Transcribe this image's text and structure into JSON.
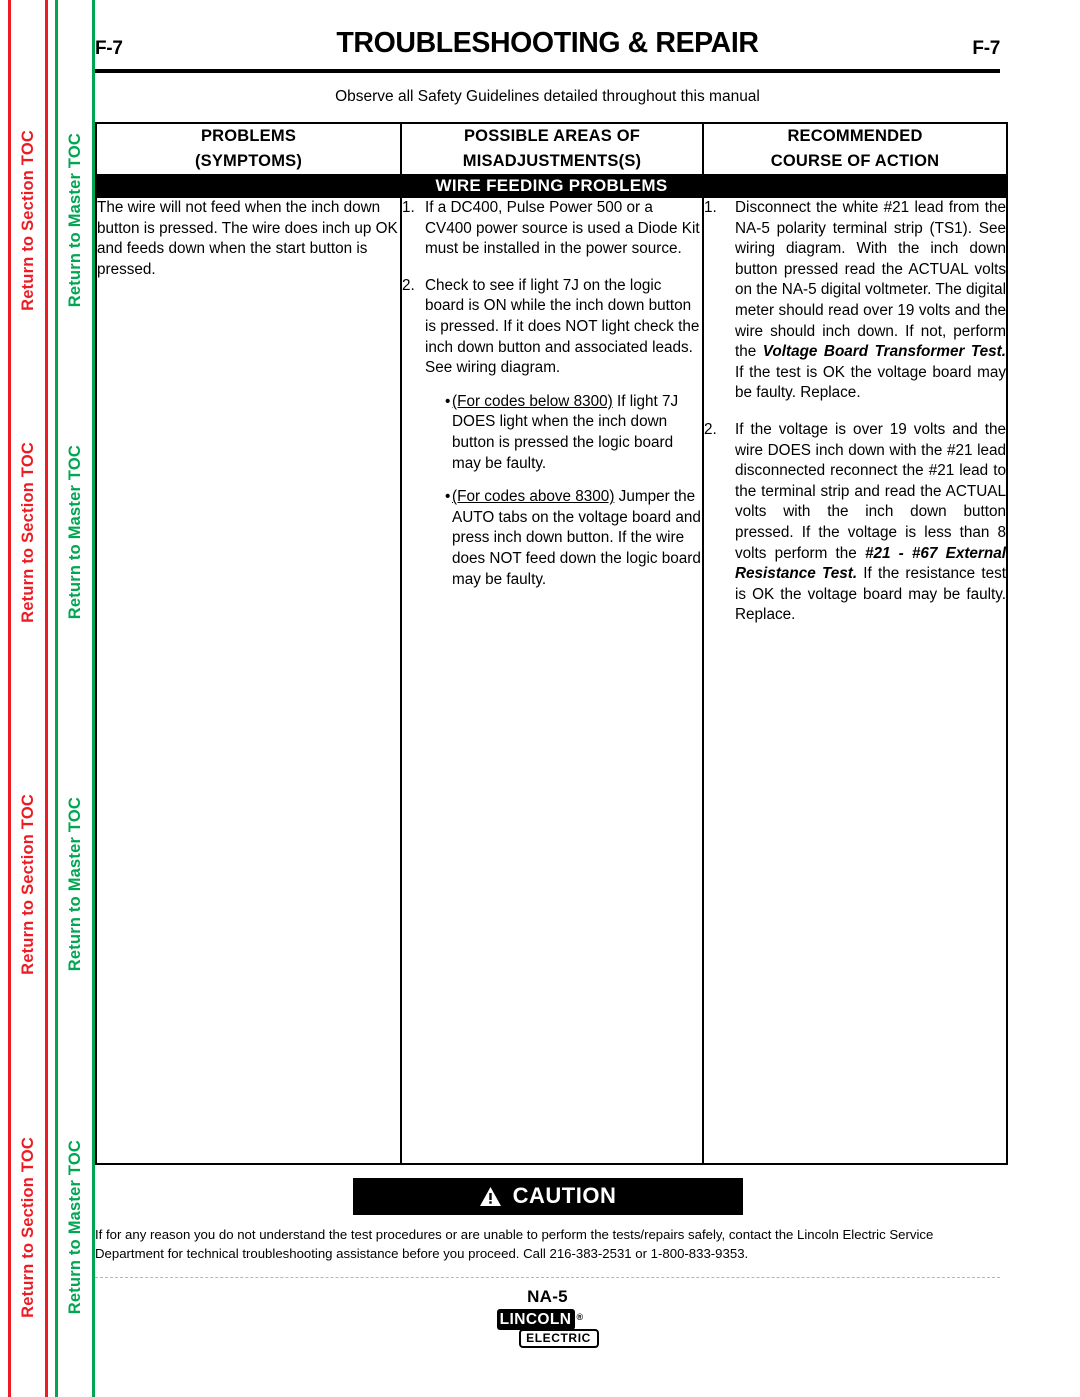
{
  "sidebar": {
    "section_toc_label": "Return to Section TOC",
    "master_toc_label": "Return to Master TOC",
    "section_toc_color": "#ed1c24",
    "master_toc_color": "#00a651",
    "repeat_count": 4
  },
  "header": {
    "folio_left": "F-7",
    "folio_right": "F-7",
    "title": "TROUBLESHOOTING & REPAIR",
    "safety_note": "Observe all Safety Guidelines detailed throughout this manual"
  },
  "table": {
    "headers": [
      {
        "line1": "PROBLEMS",
        "line2": "(SYMPTOMS)"
      },
      {
        "line1": "POSSIBLE AREAS OF",
        "line2": "MISADJUSTMENTS(S)"
      },
      {
        "line1": "RECOMMENDED",
        "line2": "COURSE OF ACTION"
      }
    ],
    "banner": "WIRE FEEDING PROBLEMS",
    "symptom": "The wire will not feed when the inch down button is pressed.  The wire does inch up OK and feeds down when the start button is pressed.",
    "misadjustments": {
      "item1_num": "1.",
      "item1_text": "If a DC400, Pulse Power 500 or a CV400 power source is used a Diode Kit must be installed in the power source.",
      "item2_num": "2.",
      "item2_text": "Check to see if light 7J on the logic board is ON while the inch down button is pressed.  If it does NOT light check the inch down button and associated leads. See wiring diagram.",
      "bullet1_marker": "•",
      "bullet1_underlined": "(For codes below 8300)",
      "bullet1_text": "  If light 7J DOES light when the inch down button is pressed the logic board may be faulty.",
      "bullet2_marker": "•",
      "bullet2_underlined": "(For codes above 8300)",
      "bullet2_text": " Jumper the AUTO tabs on the voltage board and press inch down button.  If the wire does NOT feed down the logic board may be faulty."
    },
    "action": {
      "item1_num": "1.",
      "item1_part1": "Disconnect the white #21 lead from the NA-5 polarity terminal strip (TS1).  See wiring diagram. With the inch down button pressed read the ACTUAL volts on the NA-5 digital voltmeter. The digital meter should read over 19 volts and the wire should inch down.  If not, perform the ",
      "item1_emphasis": "Voltage Board Transformer Test.",
      "item1_part2": "  If the test is OK the voltage board may be faulty.  Replace.",
      "item2_num": "2.",
      "item2_part1": "If the voltage is over 19 volts and the wire DOES inch down with the #21 lead disconnected reconnect the #21 lead to the terminal strip and read the ACTUAL volts with the inch down button pressed.  If the voltage is less than 8 volts perform the ",
      "item2_emphasis": "#21 - #67 External Resistance Test.",
      "item2_part2": "  If the resistance test is OK the voltage board may be faulty.  Replace."
    }
  },
  "caution": {
    "label": "CAUTION",
    "icon": "warning-triangle-icon",
    "text": "If for any reason you do not understand the test procedures or are unable to perform the tests/repairs safely, contact the Lincoln Electric Service Department for technical troubleshooting assistance before you proceed. Call 216-383-2531 or 1-800-833-9353."
  },
  "footer": {
    "model": "NA-5",
    "logo_primary": "LINCOLN",
    "logo_registered": "®",
    "logo_secondary": "ELECTRIC"
  }
}
